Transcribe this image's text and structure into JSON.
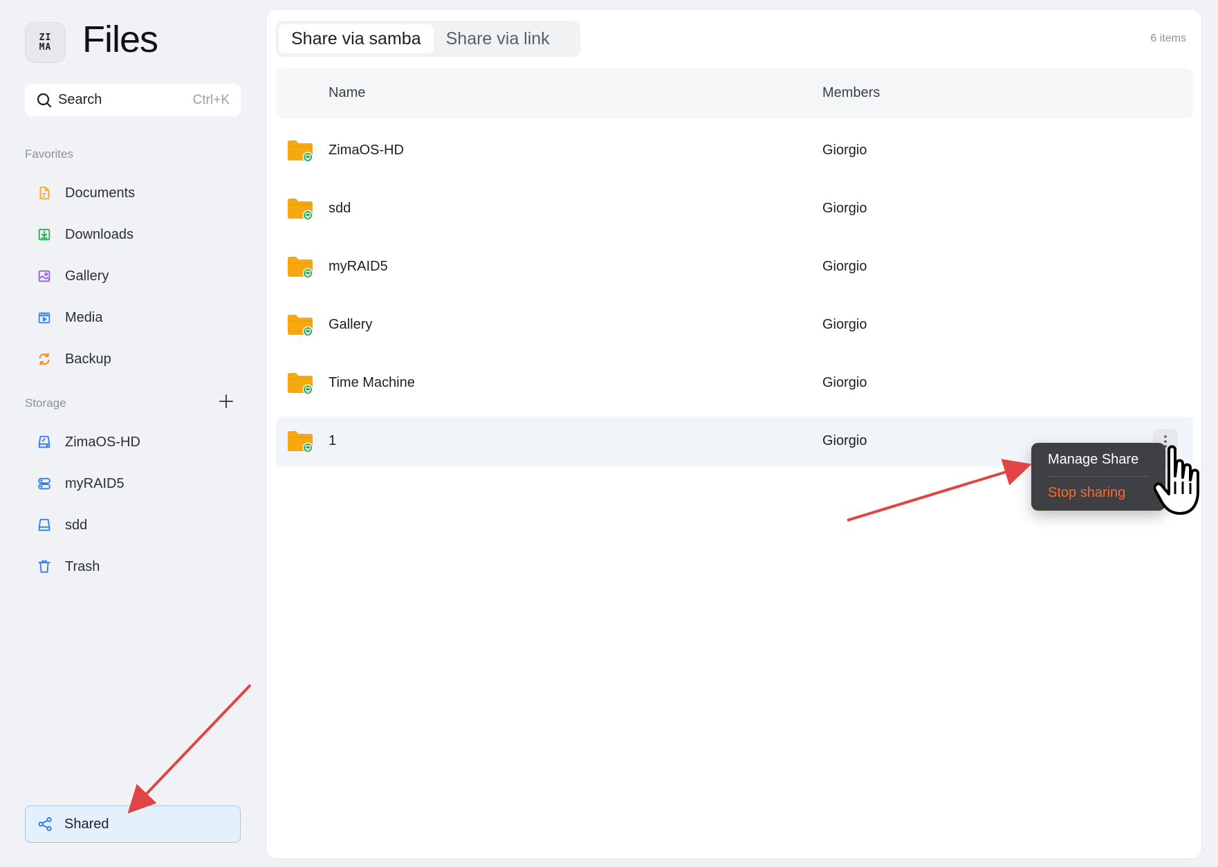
{
  "app": {
    "logo_top": "ZI",
    "logo_bottom": "MA",
    "title": "Files"
  },
  "search": {
    "label": "Search",
    "shortcut": "Ctrl+K"
  },
  "sidebar": {
    "favorites_label": "Favorites",
    "favorites": [
      {
        "label": "Documents",
        "icon": "document-icon",
        "color": "#f5a623"
      },
      {
        "label": "Downloads",
        "icon": "download-icon",
        "color": "#22b14c"
      },
      {
        "label": "Gallery",
        "icon": "gallery-icon",
        "color": "#9b5cf6"
      },
      {
        "label": "Media",
        "icon": "media-icon",
        "color": "#3b82f6"
      },
      {
        "label": "Backup",
        "icon": "backup-icon",
        "color": "#f58a1f"
      }
    ],
    "storage_label": "Storage",
    "storage": [
      {
        "label": "ZimaOS-HD",
        "icon": "disk-icon",
        "color": "#2f7ef0"
      },
      {
        "label": "myRAID5",
        "icon": "raid-icon",
        "color": "#2f7ef0"
      },
      {
        "label": "sdd",
        "icon": "drive-icon",
        "color": "#2f7ef0"
      },
      {
        "label": "Trash",
        "icon": "trash-icon",
        "color": "#2f7ef0"
      }
    ],
    "shared_label": "Shared"
  },
  "tabs": {
    "samba": "Share via samba",
    "link": "Share via link"
  },
  "item_count": "6 items",
  "table": {
    "headers": {
      "name": "Name",
      "members": "Members"
    },
    "rows": [
      {
        "name": "ZimaOS-HD",
        "members": "Giorgio"
      },
      {
        "name": "sdd",
        "members": "Giorgio"
      },
      {
        "name": "myRAID5",
        "members": "Giorgio"
      },
      {
        "name": "Gallery",
        "members": "Giorgio"
      },
      {
        "name": "Time Machine",
        "members": "Giorgio"
      },
      {
        "name": "1",
        "members": "Giorgio"
      }
    ]
  },
  "context_menu": {
    "manage": "Manage Share",
    "stop": "Stop sharing"
  },
  "colors": {
    "folder": "#f7a80f",
    "share_badge": "#22b24c",
    "accent": "#2f7ef0",
    "danger": "#ff6a2b",
    "arrow": "#e04444"
  }
}
